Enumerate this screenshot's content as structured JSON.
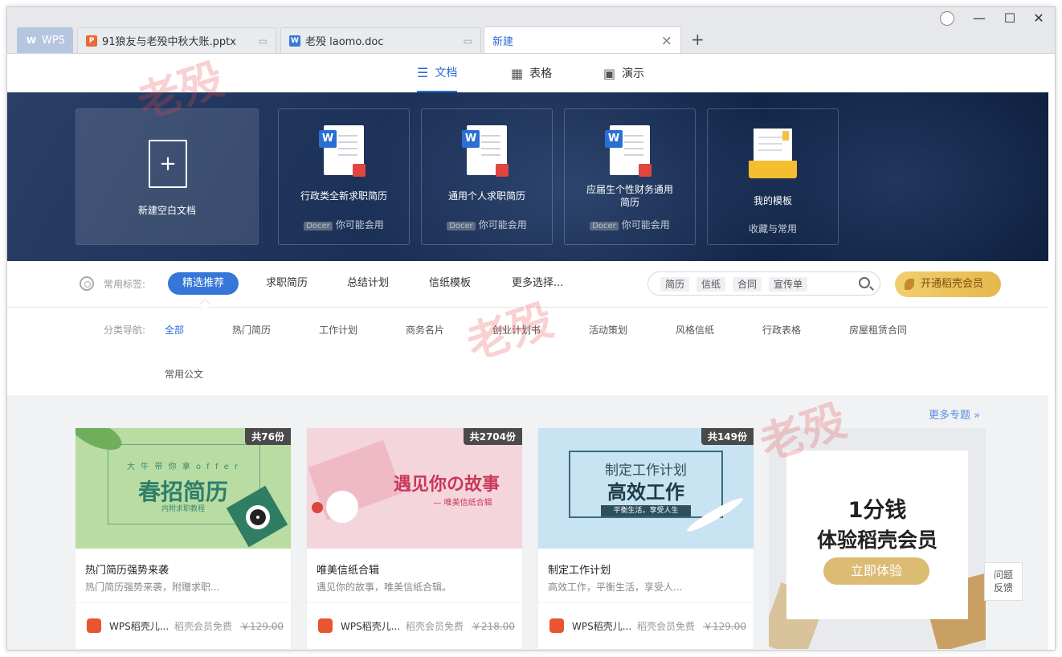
{
  "tabs": [
    {
      "label": "WPS"
    },
    {
      "label": "91狼友与老殁中秋大账.pptx"
    },
    {
      "label": "老殁 laomo.doc"
    },
    {
      "label": "新建"
    }
  ],
  "doc_types": [
    {
      "label": "文档",
      "icon": "lines-icon",
      "active": true
    },
    {
      "label": "表格",
      "icon": "grid-icon",
      "active": false
    },
    {
      "label": "演示",
      "icon": "presentation-icon",
      "active": false
    }
  ],
  "banner": {
    "blank_label": "新建空白文档",
    "cards": [
      {
        "title": "行政类全新求职简历",
        "tag": "Docer",
        "sub": "你可能会用"
      },
      {
        "title": "通用个人求职简历",
        "tag": "Docer",
        "sub": "你可能会用"
      },
      {
        "title": "应届生个性财务通用简历",
        "tag": "Docer",
        "sub": "你可能会用"
      }
    ],
    "my_templates": {
      "title": "我的模板",
      "sub": "收藏与常用"
    }
  },
  "tags": {
    "label": "常用标签:",
    "items": [
      "精选推荐",
      "求职简历",
      "总结计划",
      "信纸模板",
      "更多选择..."
    ],
    "search_chips": [
      "简历",
      "信纸",
      "合同",
      "宣传单"
    ],
    "vip_button": "开通稻壳会员"
  },
  "categories": {
    "label": "分类导航:",
    "items": [
      "全部",
      "热门简历",
      "工作计划",
      "商务名片",
      "创业计划书",
      "活动策划",
      "风格信纸",
      "行政表格",
      "房屋租赁合同",
      "常用公文"
    ]
  },
  "more_topics": "更多专题 »",
  "templates": [
    {
      "count": "共76份",
      "img_title": "春招简历",
      "img_sub": "内附求职教程",
      "img_top": "大 牛 带 你 拿 o f f e r",
      "title": "热门简历强势来袭",
      "desc": "热门简历强势来袭，附赠求职...",
      "author": "WPS稻壳儿...",
      "free": "稻壳会员免费",
      "price": "￥129.00"
    },
    {
      "count": "共2704份",
      "img_title": "遇见你の故事",
      "img_sub": "— 唯美信纸合辑",
      "img_top": "",
      "title": "唯美信纸合辑",
      "desc": "遇见你的故事，唯美信纸合辑。",
      "author": "WPS稻壳儿...",
      "free": "稻壳会员免费",
      "price": "￥218.00"
    },
    {
      "count": "共149份",
      "img_title": "高效工作",
      "img_sub": "平衡生活，享受人生",
      "img_top": "制定工作计划",
      "title": "制定工作计划",
      "desc": "高效工作，平衡生活，享受人...",
      "author": "WPS稻壳儿...",
      "free": "稻壳会员免费",
      "price": "￥129.00"
    }
  ],
  "ad": {
    "line1": "1分钱",
    "line2": "体验稻壳会员",
    "button": "立即体验"
  },
  "feedback": {
    "line1": "问题",
    "line2": "反馈"
  },
  "watermark": "老殁",
  "colors": {
    "accent": "#3576d8",
    "banner": "#1d3259",
    "vip": "#e6b84d"
  }
}
